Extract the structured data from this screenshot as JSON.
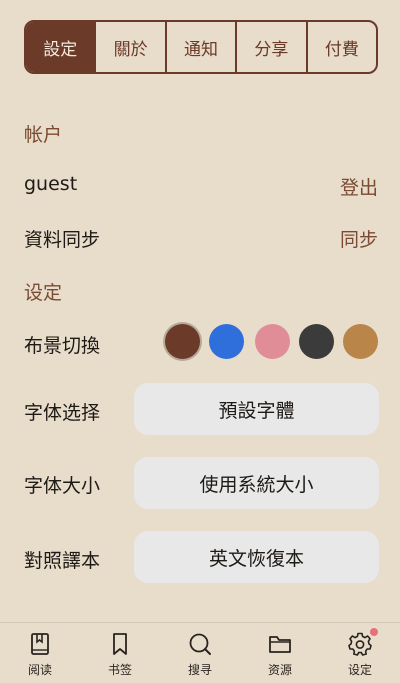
{
  "tabs": [
    {
      "label": "設定",
      "active": true
    },
    {
      "label": "關於",
      "active": false
    },
    {
      "label": "通知",
      "active": false
    },
    {
      "label": "分享",
      "active": false
    },
    {
      "label": "付費",
      "active": false
    }
  ],
  "account": {
    "heading": "帐户",
    "username": "guest",
    "logout_label": "登出",
    "sync_label": "資料同步",
    "sync_action": "同步"
  },
  "settings": {
    "heading": "设定",
    "background_label": "布景切換",
    "background_colors": [
      "#6b3a28",
      "#2f6fdb",
      "#e08d97",
      "#3b3b3b",
      "#b98548"
    ],
    "selected_background": 0,
    "font_label": "字体选择",
    "font_value": "預設字體",
    "size_label": "字体大小",
    "size_value": "使用系統大小",
    "compare_label": "對照譯本",
    "compare_value": "英文恢復本"
  },
  "nav": [
    {
      "label": "阅读",
      "icon": "book-icon"
    },
    {
      "label": "书签",
      "icon": "bookmark-icon"
    },
    {
      "label": "搜寻",
      "icon": "search-icon"
    },
    {
      "label": "资源",
      "icon": "folder-icon"
    },
    {
      "label": "设定",
      "icon": "gear-icon",
      "badge": true
    }
  ],
  "colors": {
    "accent": "#6b3a28",
    "background": "#e8dccb",
    "badge": "#e8707c"
  }
}
